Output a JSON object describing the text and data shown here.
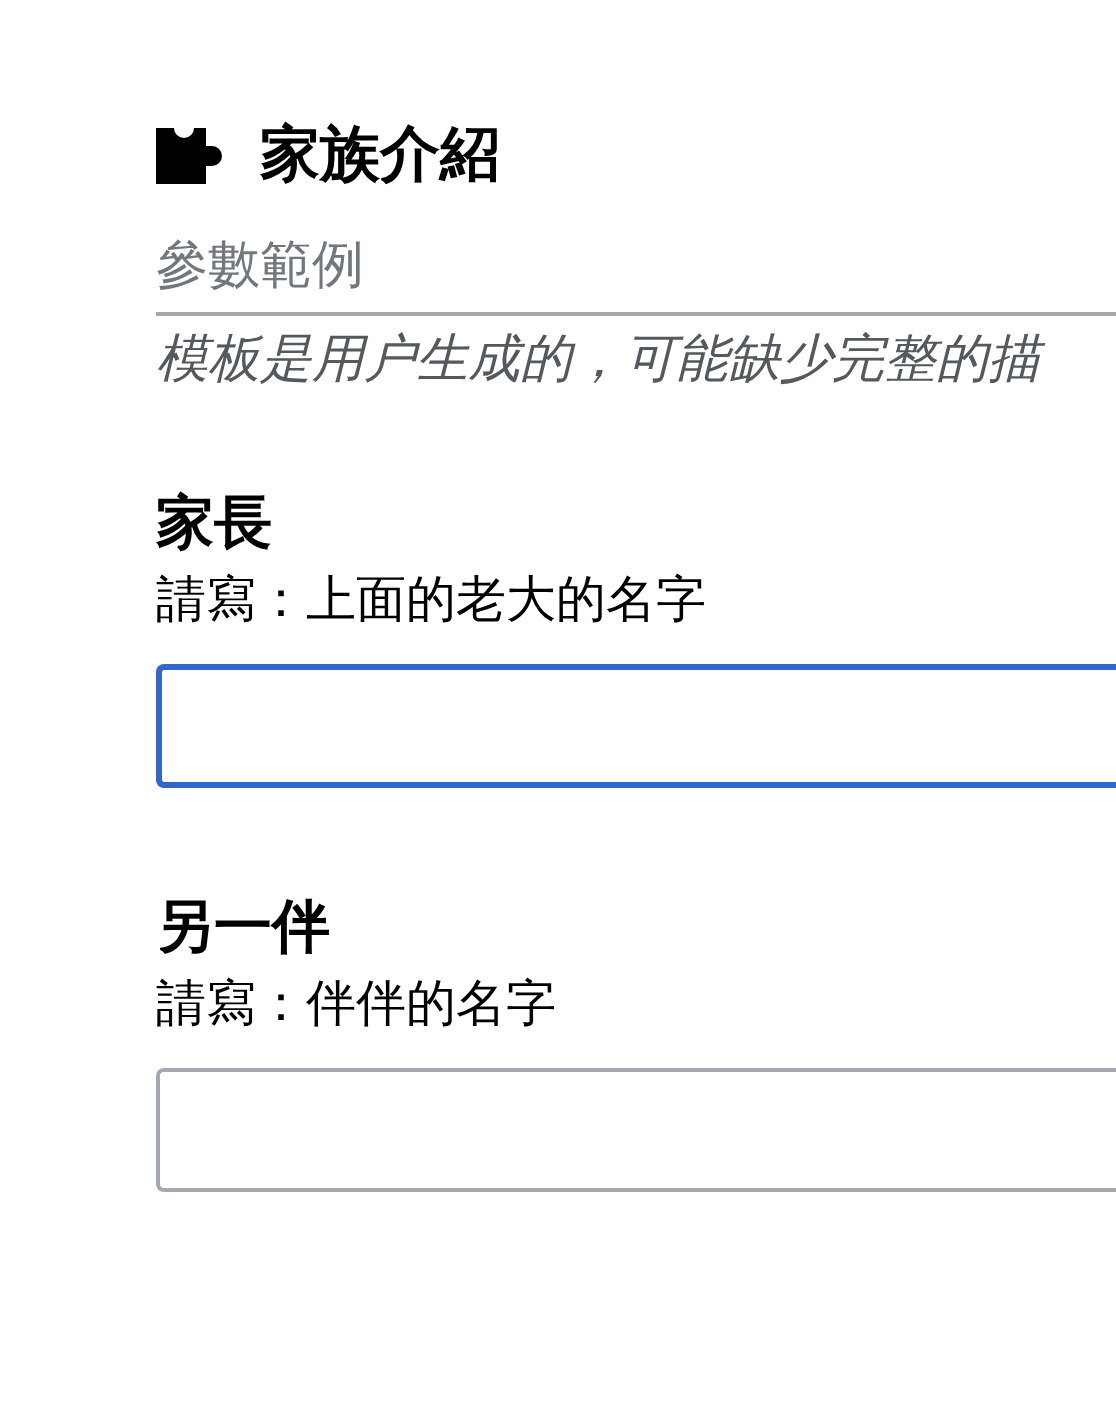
{
  "header": {
    "title": "家族介紹"
  },
  "subtitle": "參數範例",
  "note": "模板是用户生成的，可能缺少完整的描",
  "fields": [
    {
      "label": "家長",
      "hint": "請寫：上面的老大的名字",
      "focused": true
    },
    {
      "label": "另一伴",
      "hint": "請寫：伴伴的名字",
      "focused": false
    }
  ]
}
